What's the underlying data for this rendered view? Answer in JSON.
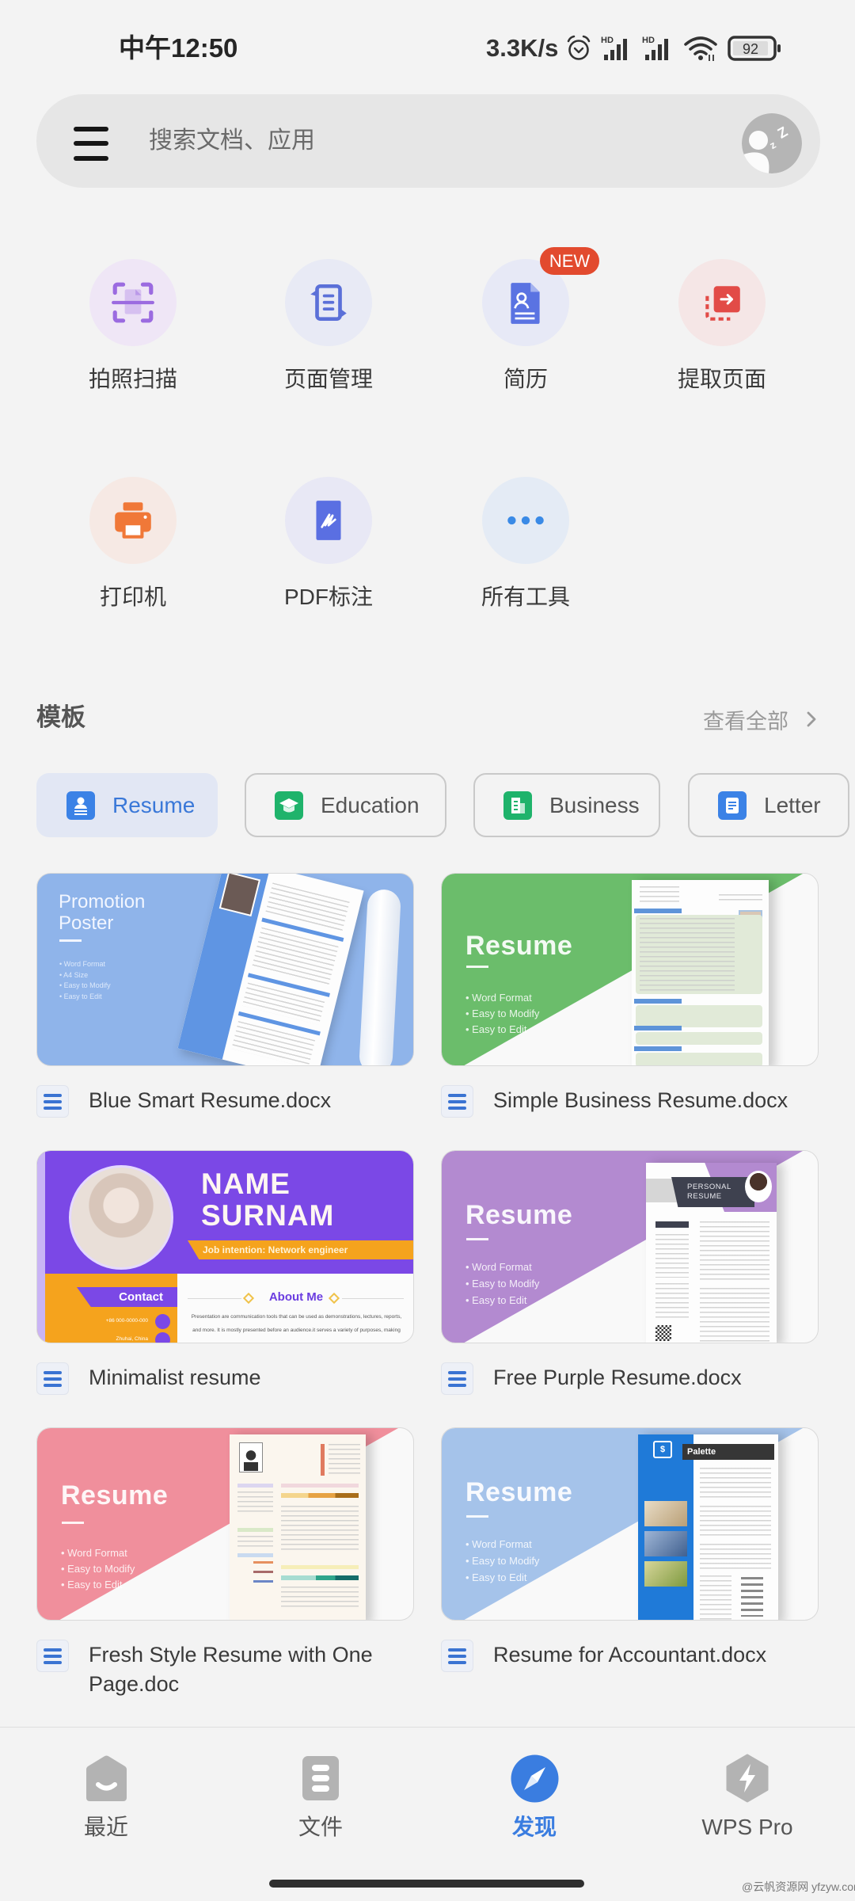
{
  "status_bar": {
    "time": "中午12:50",
    "net_speed": "3.3K/s",
    "hd_label": "HD",
    "battery": "92",
    "icons": [
      "alarm-icon",
      "hd-signal-icon",
      "hd-signal-icon",
      "wifi-icon",
      "battery-icon"
    ]
  },
  "search": {
    "placeholder": "搜索文档、应用",
    "value": "",
    "menu_icon": "hamburger-menu-icon",
    "avatar_icon": "sleeping-avatar-icon",
    "avatar_text": "z"
  },
  "tools": [
    {
      "label": "拍照扫描",
      "icon": "scan-icon",
      "color": "#9b6be0",
      "bg": "#efe6f6"
    },
    {
      "label": "页面管理",
      "icon": "page-manage-icon",
      "color": "#5b70d8",
      "bg": "#e8eaf5"
    },
    {
      "label": "简历",
      "icon": "resume-icon",
      "color": "#5a73e2",
      "bg": "#e7e9f6",
      "badge": "NEW"
    },
    {
      "label": "提取页面",
      "icon": "extract-page-icon",
      "color": "#e24b47",
      "bg": "#f5e6e6"
    },
    {
      "label": "打印机",
      "icon": "printer-icon",
      "color": "#f07838",
      "bg": "#f6e9e4"
    },
    {
      "label": "PDF标注",
      "icon": "pdf-annotate-icon",
      "color": "#5a6fe2",
      "bg": "#e8e8f5"
    },
    {
      "label": "所有工具",
      "icon": "more-dots-icon",
      "color": "#3a8ae6",
      "bg": "#e4ebf5"
    }
  ],
  "templates": {
    "title": "模板",
    "view_all": "查看全部",
    "categories": [
      {
        "label": "Resume",
        "icon": "resume-category-icon",
        "active": true,
        "icon_color": "#3b82e6"
      },
      {
        "label": "Education",
        "icon": "graduation-cap-icon",
        "active": false,
        "icon_color": "#1fb36b"
      },
      {
        "label": "Business",
        "icon": "building-icon",
        "active": false,
        "icon_color": "#1fb36b"
      },
      {
        "label": "Letter",
        "icon": "letter-icon",
        "active": false,
        "icon_color": "#3b82e6"
      }
    ],
    "cards": [
      {
        "name": "Blue Smart Resume.docx",
        "thumb": {
          "title": "Promotion Poster",
          "bullets": [
            "Word Format",
            "A4 Size",
            "Easy to Modify",
            "Easy to Edit"
          ],
          "color": "#8fb4ea"
        }
      },
      {
        "name": "Simple Business Resume.docx",
        "thumb": {
          "title": "Resume",
          "bullets": [
            "Word Format",
            "Easy to Modify",
            "Easy to Edit"
          ],
          "color": "#6bbd6b"
        }
      },
      {
        "name": "Minimalist resume",
        "thumb": {
          "name_line1": "NAME",
          "name_line2": "SURNAM",
          "job": "Job intention: Network engineer",
          "contact": "Contact",
          "phone": "+86 000-0000-000",
          "location": "Zhuhai, China",
          "about": "About Me",
          "about_text": "Presentation are communication tools that can be used as demonstrations, lectures, reports, and more. It is mostly presented before an audience.it serves a variety of purposes, making",
          "color": "#7b48e6",
          "accent": "#f5a31d"
        }
      },
      {
        "name": "Free Purple Resume.docx",
        "thumb": {
          "title": "Resume",
          "bullets": [
            "Word Format",
            "Easy to Modify",
            "Easy to Edit"
          ],
          "paper_header": "PERSONAL RESUME",
          "color": "#b38ad0"
        }
      },
      {
        "name": "Fresh Style Resume with One Page.doc",
        "thumb": {
          "title": "Resume",
          "bullets": [
            "Word Format",
            "Easy to Modify",
            "Easy to Edit"
          ],
          "color": "#f08f9c"
        }
      },
      {
        "name": "Resume for Accountant.docx",
        "thumb": {
          "title": "Resume",
          "bullets": [
            "Word Format",
            "Easy to Modify",
            "Easy to Edit"
          ],
          "paper_header": "Palette",
          "color": "#a5c3ea"
        }
      }
    ]
  },
  "bottom_nav": {
    "items": [
      {
        "label": "最近",
        "icon": "recent-icon",
        "active": false
      },
      {
        "label": "文件",
        "icon": "files-icon",
        "active": false
      },
      {
        "label": "发现",
        "icon": "discover-compass-icon",
        "active": true
      },
      {
        "label": "WPS Pro",
        "icon": "wps-pro-bolt-icon",
        "active": false
      }
    ],
    "active_color": "#3a7de0",
    "inactive_label_color": "#555555"
  },
  "watermark": "@云帆资源网 yfzyw.com"
}
